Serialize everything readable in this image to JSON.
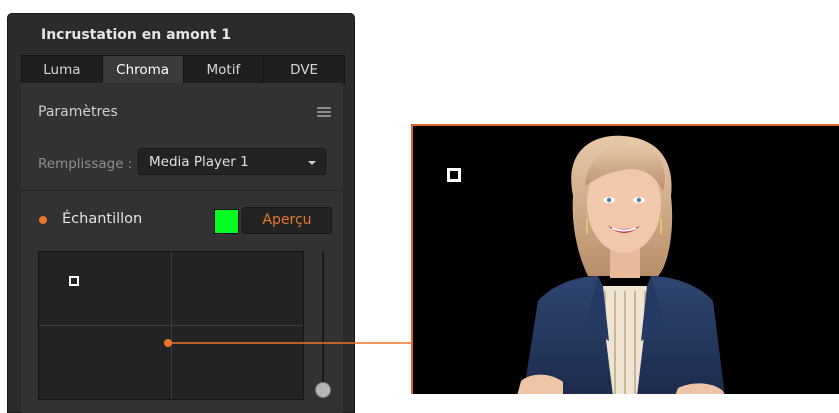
{
  "panel": {
    "title": "Incrustation en amont 1",
    "tabs": [
      {
        "label": "Luma",
        "active": false
      },
      {
        "label": "Chroma",
        "active": true
      },
      {
        "label": "Motif",
        "active": false
      },
      {
        "label": "DVE",
        "active": false
      }
    ],
    "params_title": "Paramètres",
    "fill_label": "Remplissage :",
    "fill_value": "Media Player 1",
    "sample_label": "Échantillon",
    "preview_label": "Aperçu"
  },
  "colors": {
    "accent": "#e8762c",
    "swatch": "#00ff1e",
    "panel_bg": "#2b2b2b"
  },
  "icons": {
    "menu": "hamburger-icon",
    "select_caret": "chevron-down-icon",
    "status_dot": "orange-dot-icon"
  },
  "video": {
    "subject": "woman in navy blazer on black background"
  }
}
